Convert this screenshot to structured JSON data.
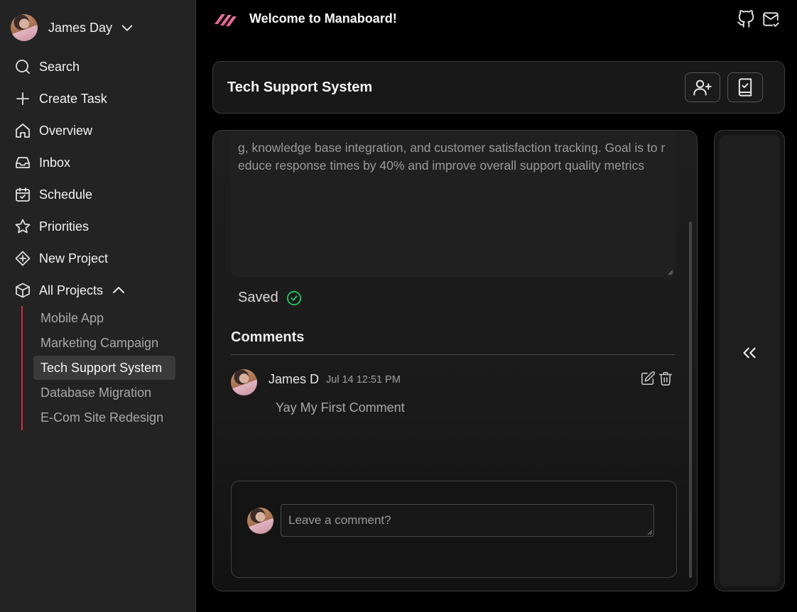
{
  "user": {
    "name": "James Day"
  },
  "sidebar": {
    "nav": [
      {
        "label": "Search",
        "icon": "search-icon"
      },
      {
        "label": "Create Task",
        "icon": "plus-icon"
      },
      {
        "label": "Overview",
        "icon": "home-icon"
      },
      {
        "label": "Inbox",
        "icon": "inbox-icon"
      },
      {
        "label": "Schedule",
        "icon": "calendar-check-icon"
      },
      {
        "label": "Priorities",
        "icon": "star-icon"
      },
      {
        "label": "New Project",
        "icon": "diamond-plus-icon"
      },
      {
        "label": "All Projects",
        "icon": "box-icon"
      }
    ],
    "projects": [
      {
        "label": "Mobile App",
        "active": false
      },
      {
        "label": "Marketing Campaign",
        "active": false
      },
      {
        "label": "Tech Support System",
        "active": true
      },
      {
        "label": "Database Migration",
        "active": false
      },
      {
        "label": "E-Com Site Redesign",
        "active": false
      }
    ],
    "accent": "#d6294d"
  },
  "topbar": {
    "welcome": "Welcome to Manaboard!",
    "icons": [
      "github-icon",
      "mail-check-icon"
    ]
  },
  "project": {
    "title": "Tech Support System",
    "actions": [
      "add-member-icon",
      "book-check-icon"
    ]
  },
  "task": {
    "description": "g, knowledge base integration, and customer satisfaction tracking. Goal is to reduce response times by 40% and improve overall support quality metrics",
    "save_status": "Saved",
    "save_color": "#22c55e"
  },
  "comments": {
    "heading": "Comments",
    "items": [
      {
        "author": "James D",
        "time": "Jul 14 12:51 PM",
        "text": "Yay My First Comment"
      }
    ],
    "placeholder": "Leave a comment?"
  },
  "right_panel": {
    "icon": "chevrons-left-icon"
  }
}
